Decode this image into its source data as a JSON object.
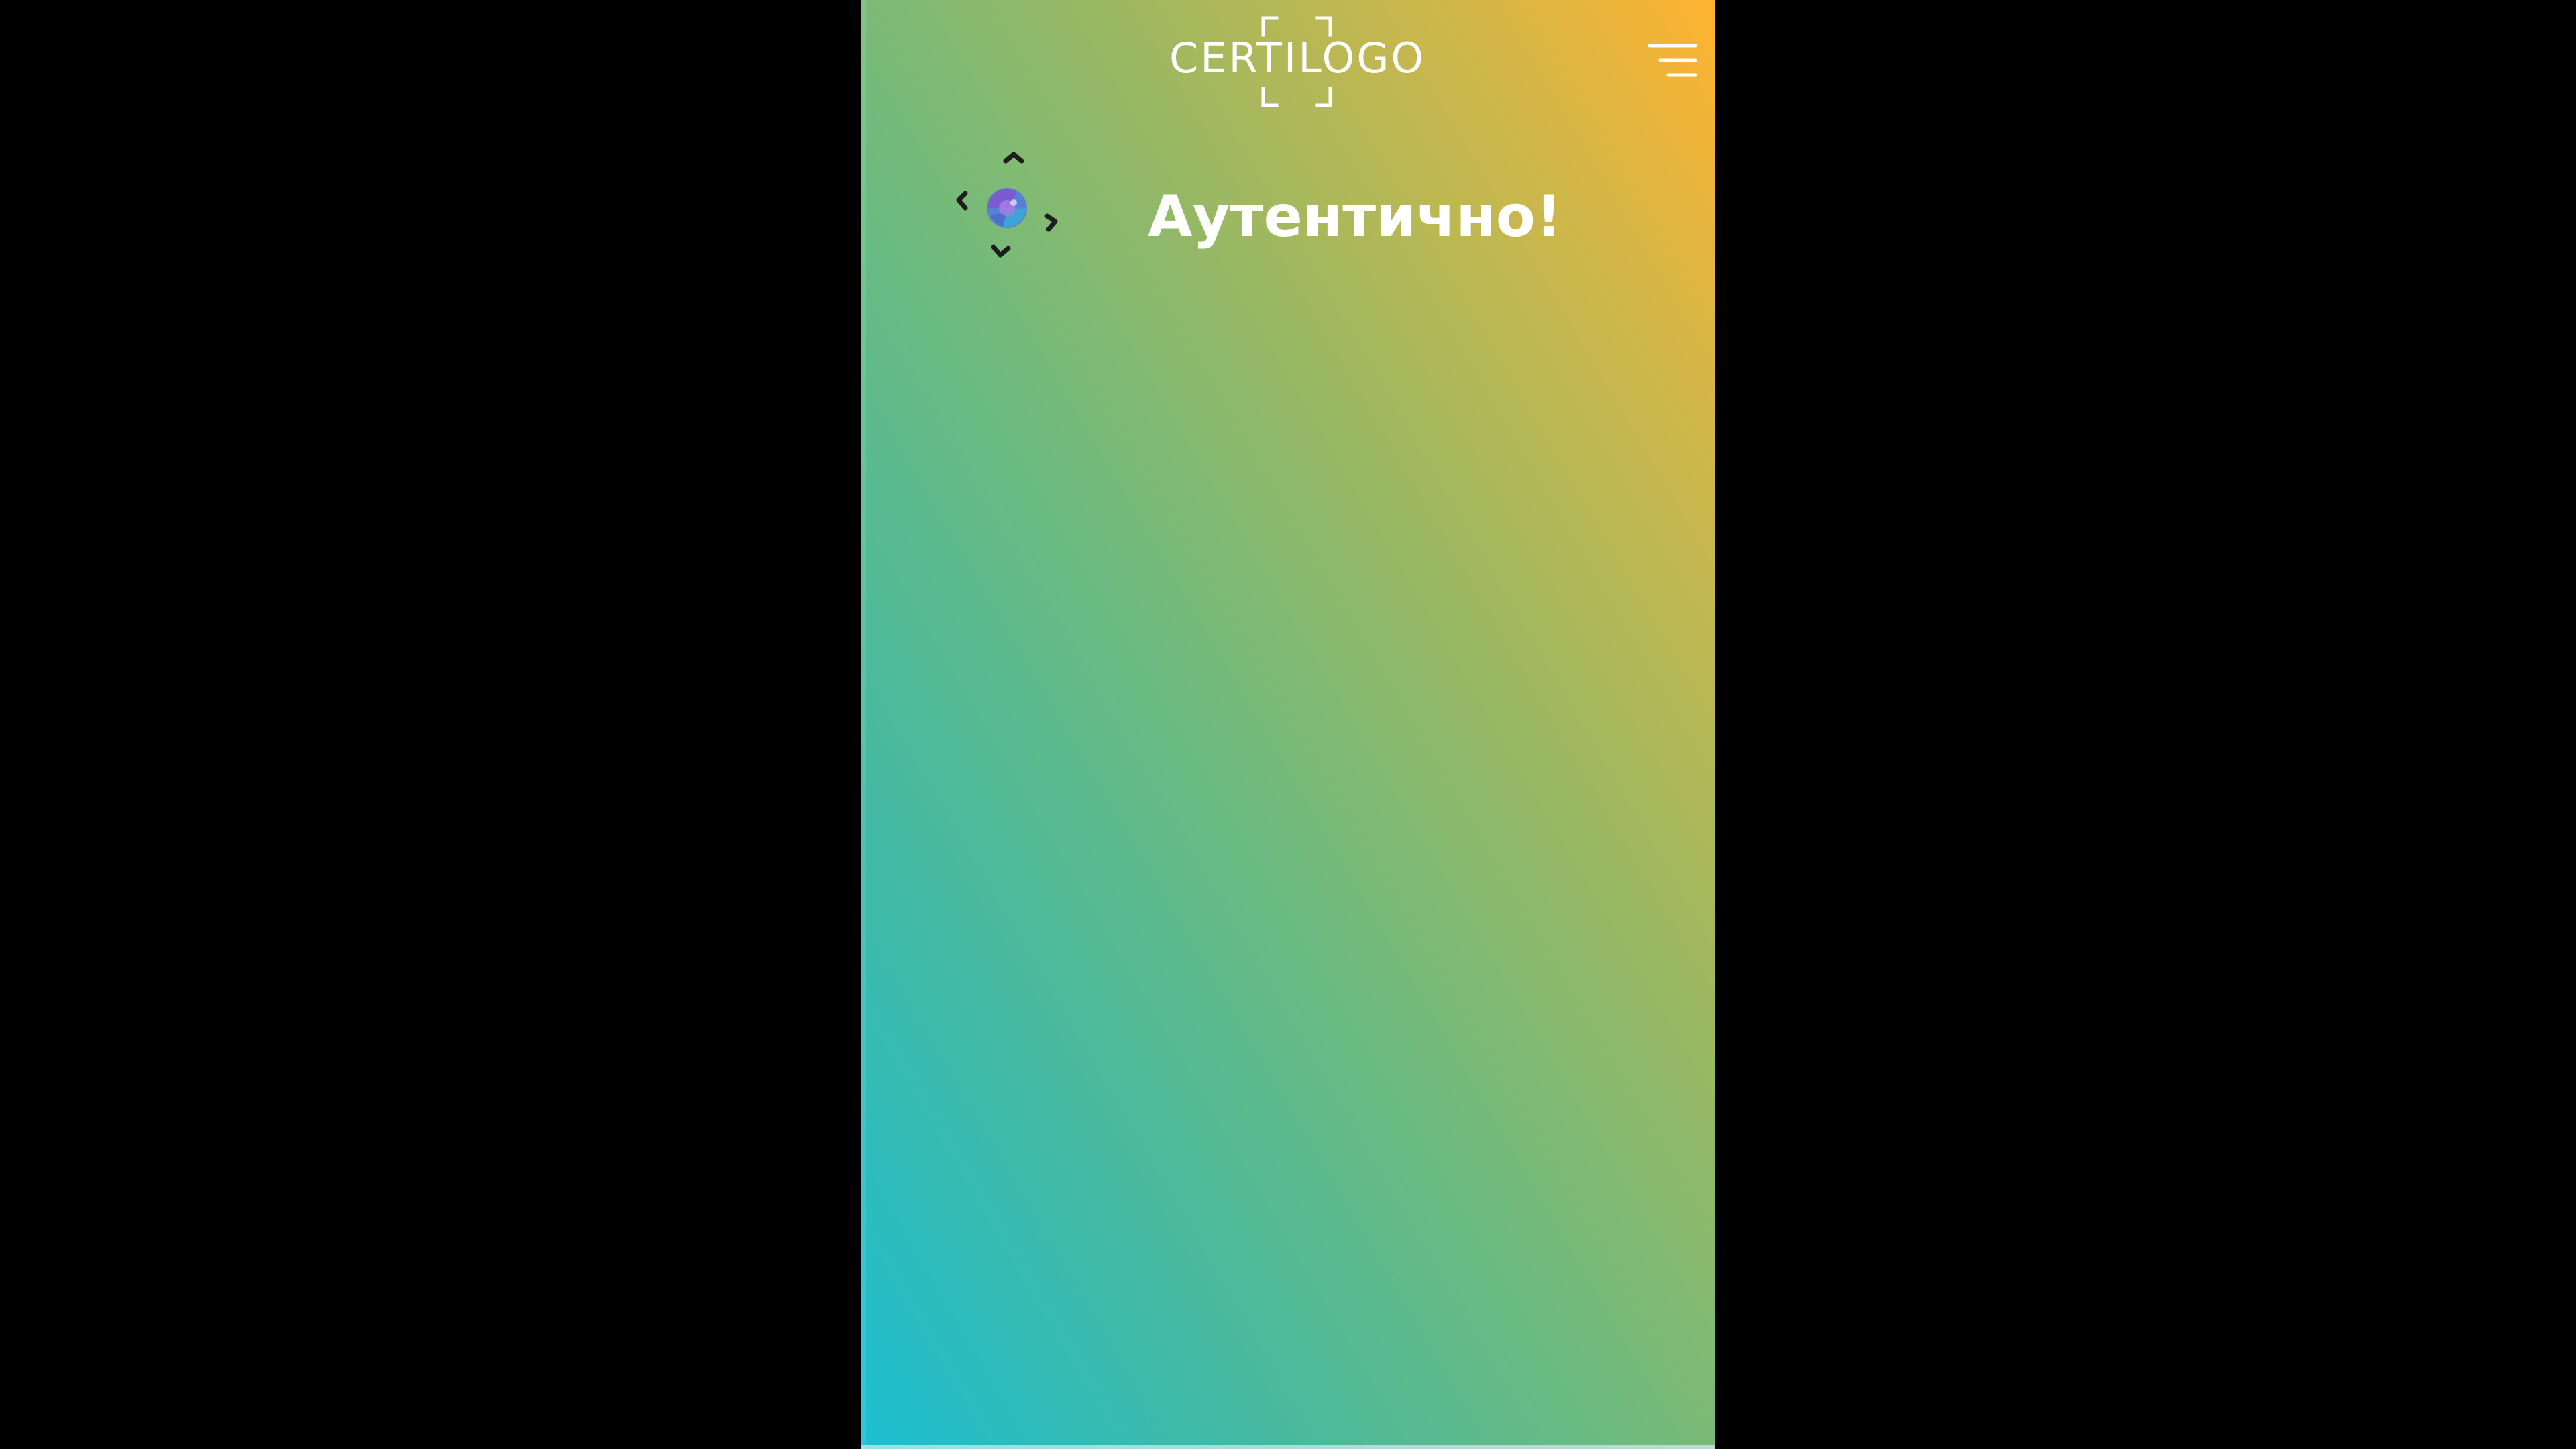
{
  "header": {
    "logo_text": "CERTILOGO",
    "menu_icon": "hamburger-menu-icon"
  },
  "result": {
    "icon": "authentic-scan-icon",
    "status_text": "Аутентично!"
  },
  "colors": {
    "gradient_top": "#ffb330",
    "gradient_bottom": "#1cbfd2",
    "text": "#ffffff",
    "background": "#000000"
  }
}
